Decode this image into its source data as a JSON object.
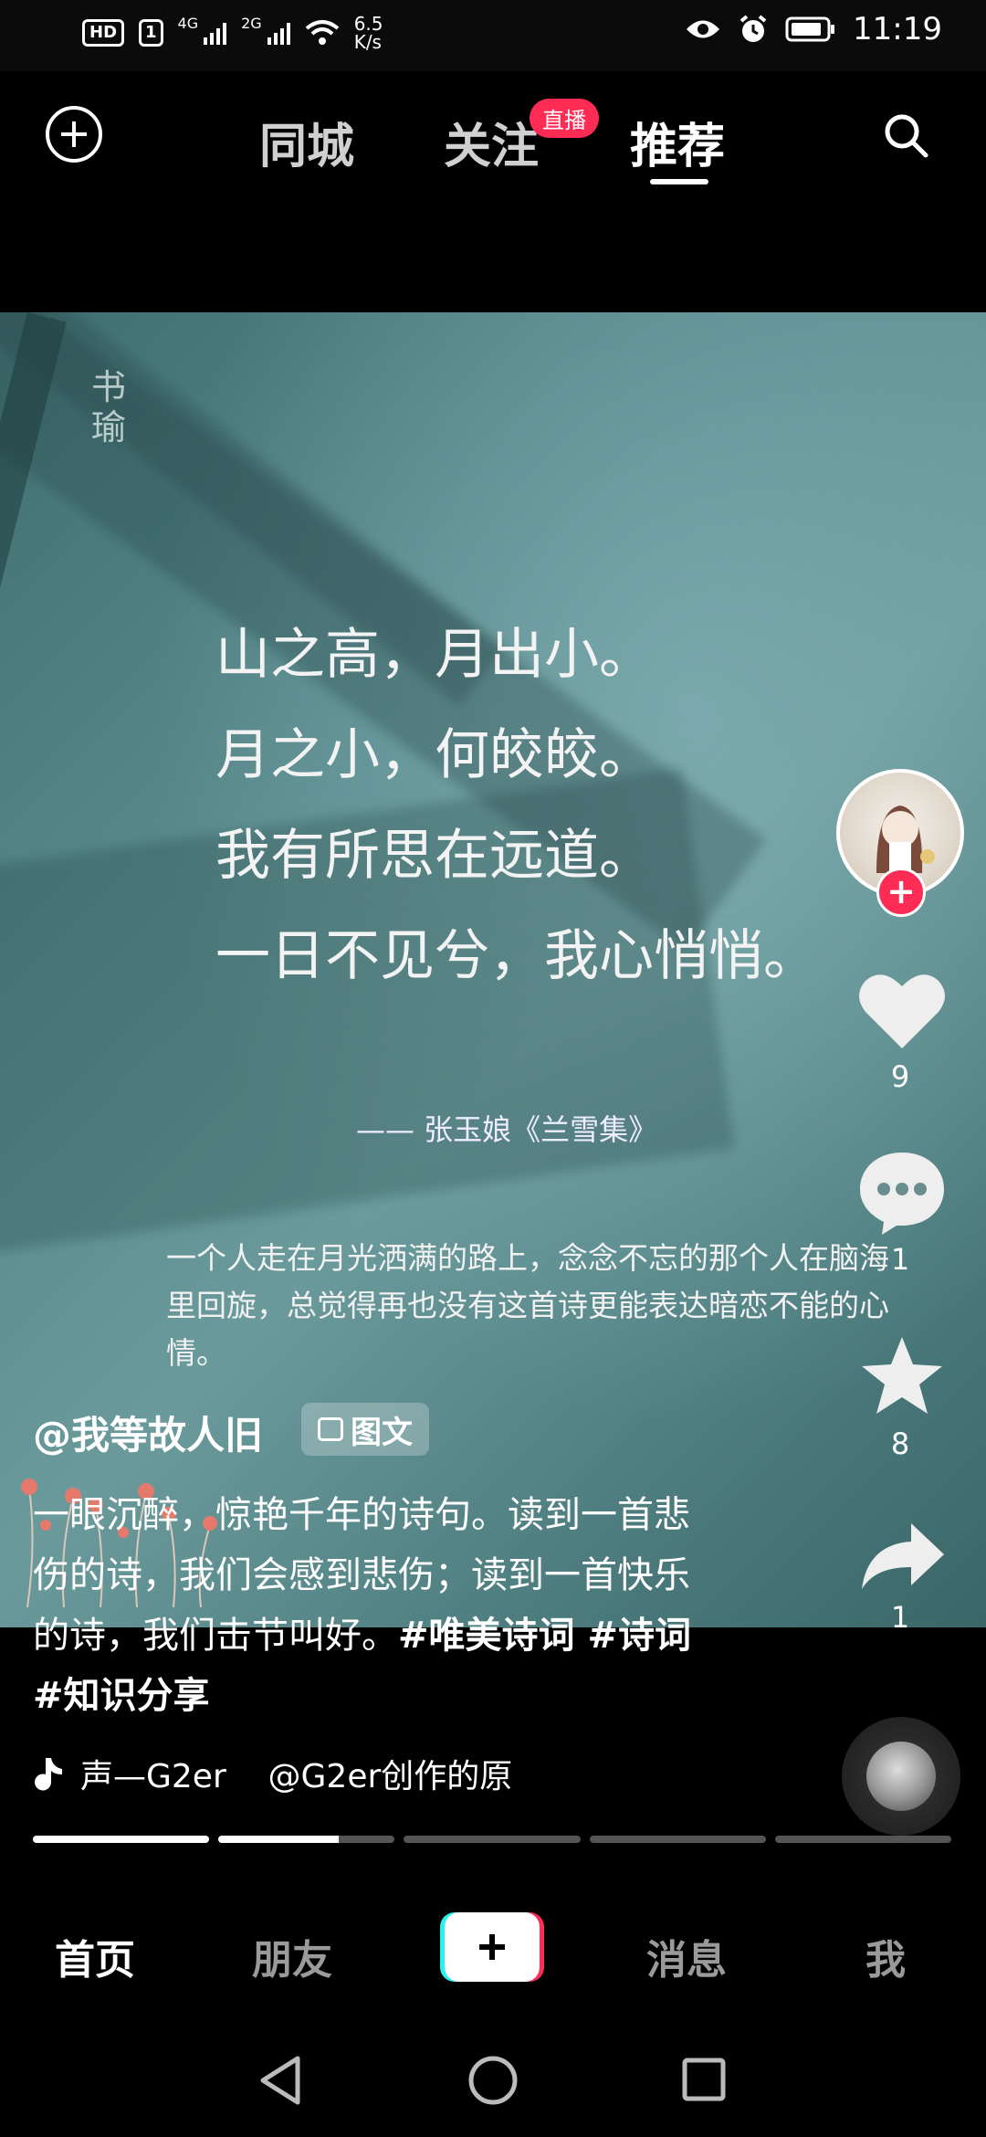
{
  "status_bar": {
    "hd_label": "HD",
    "sim1_label": "1",
    "net1": "4G",
    "net2": "2G",
    "speed_value": "6.5",
    "speed_unit": "K/s",
    "time": "11:19"
  },
  "top_nav": {
    "tabs": [
      {
        "label": "同城"
      },
      {
        "label": "关注"
      },
      {
        "label": "推荐"
      }
    ],
    "live_badge": "直播"
  },
  "post": {
    "watermark": "书瑜",
    "poem_lines": [
      "山之高，月出小。",
      "月之小，何皎皎。",
      "我有所思在远道。",
      "一日不见兮，我心悄悄。"
    ],
    "source": "—— 张玉娘《兰雪集》",
    "description": "一个人走在月光洒满的路上，念念不忘的那个人在脑海里回旋，总觉得再也没有这首诗更能表达暗恋不能的心情。",
    "author": "@我等故人旧",
    "type_badge": "图文",
    "caption_text": "一眼沉醉，惊艳千年的诗句。读到一首悲伤的诗，我们会感到悲伤；读到一首快乐的诗，我们击节叫好。",
    "hashtags": "#唯美诗词 #诗词 #知识分享",
    "music": "声—G2er    @G2er创作的原"
  },
  "actions": {
    "likes": "9",
    "comments": "1",
    "favorites": "8",
    "shares": "1"
  },
  "progress": {
    "segments": 5,
    "current_index": 1,
    "current_fill": 0.68
  },
  "bottom_nav": {
    "items": [
      {
        "label": "首页"
      },
      {
        "label": "朋友"
      },
      {
        "label": "消息"
      },
      {
        "label": "我"
      }
    ]
  },
  "colors": {
    "accent": "#fe2c55",
    "tiktok_cyan": "#25f4ee"
  }
}
